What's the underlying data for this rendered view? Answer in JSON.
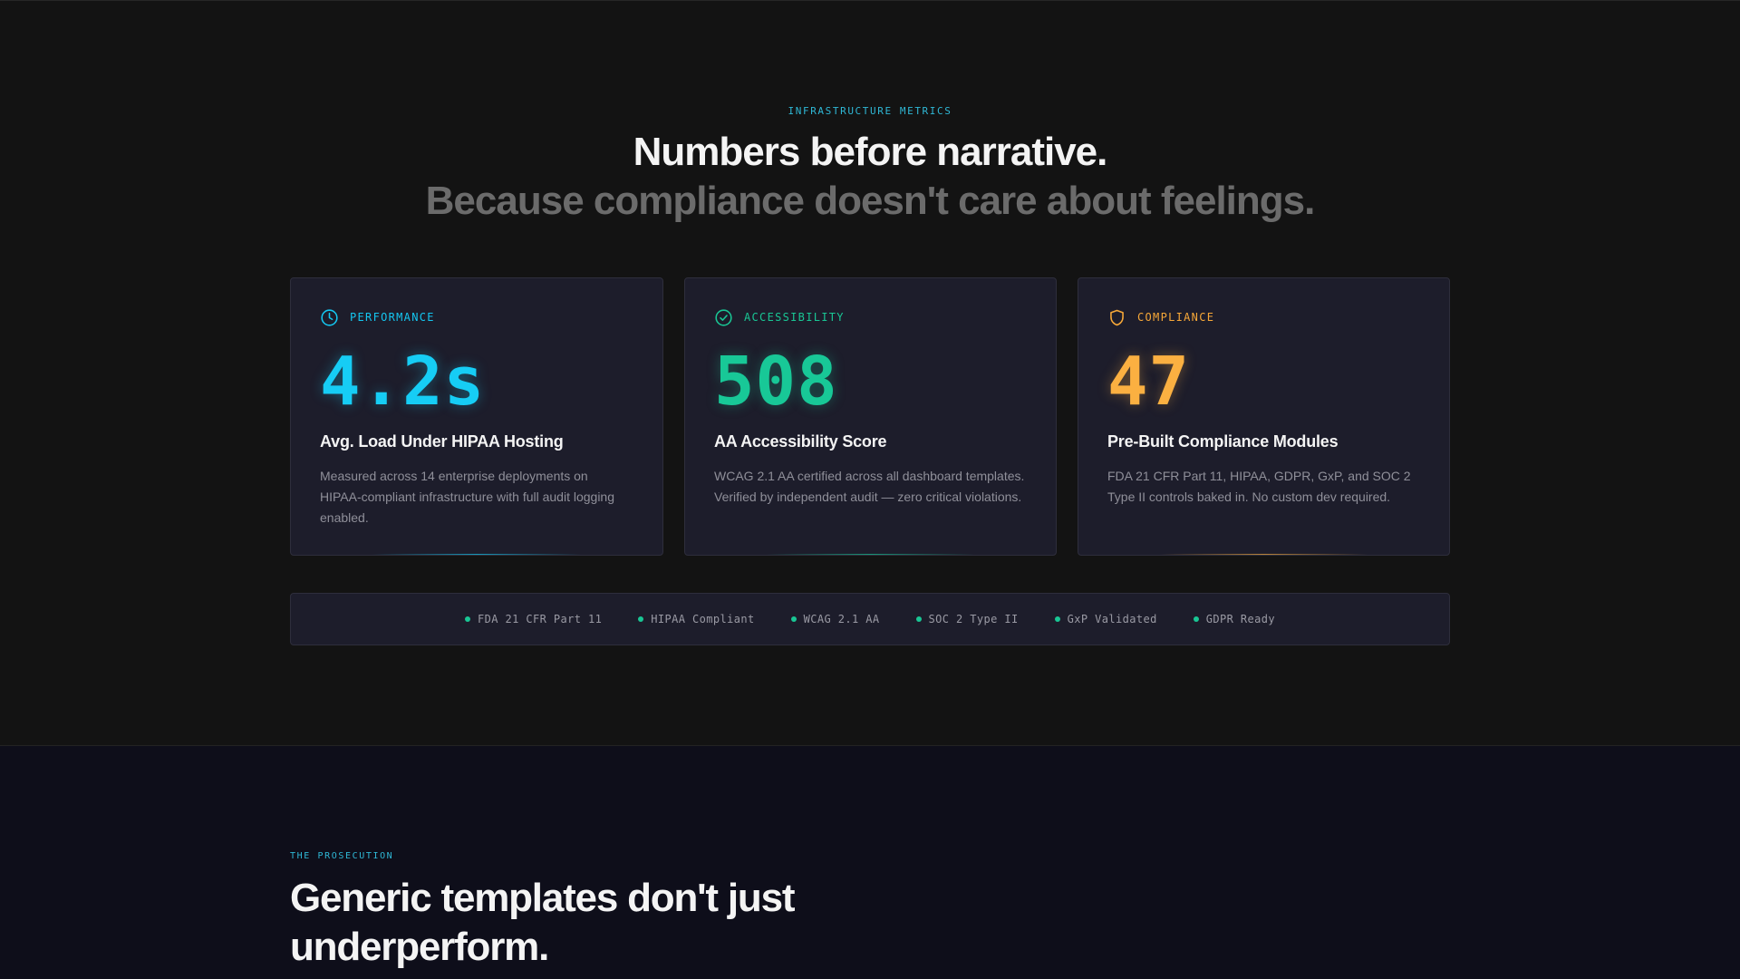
{
  "metrics": {
    "eyebrow": "INFRASTRUCTURE METRICS",
    "headline": "Numbers before narrative.",
    "subline": "Because compliance doesn't care about feelings.",
    "cards": [
      {
        "icon": "clock-icon",
        "label": "PERFORMANCE",
        "value": "4.2s",
        "title": "Avg. Load Under HIPAA Hosting",
        "description": "Measured across 14 enterprise deployments on HIPAA-compliant infrastructure with full audit logging enabled.",
        "accent": "#16cdf5"
      },
      {
        "icon": "check-circle-icon",
        "label": "ACCESSIBILITY",
        "value": "508",
        "title": "AA Accessibility Score",
        "description": "WCAG 2.1 AA certified across all dashboard templates. Verified by independent audit — zero critical violations.",
        "accent": "#18c897"
      },
      {
        "icon": "shield-icon",
        "label": "COMPLIANCE",
        "value": "47",
        "title": "Pre-Built Compliance Modules",
        "description": "FDA 21 CFR Part 11, HIPAA, GDPR, GxP, and SOC 2 Type II controls baked in. No custom dev required.",
        "accent": "#fbb041"
      }
    ],
    "badges": [
      "FDA 21 CFR Part 11",
      "HIPAA Compliant",
      "WCAG 2.1 AA",
      "SOC 2 Type II",
      "GxP Validated",
      "GDPR Ready"
    ],
    "badge_dot_color": "#19c694"
  },
  "prosecution": {
    "eyebrow": "THE PROSECUTION",
    "heading": "Generic templates don't just underperform."
  }
}
